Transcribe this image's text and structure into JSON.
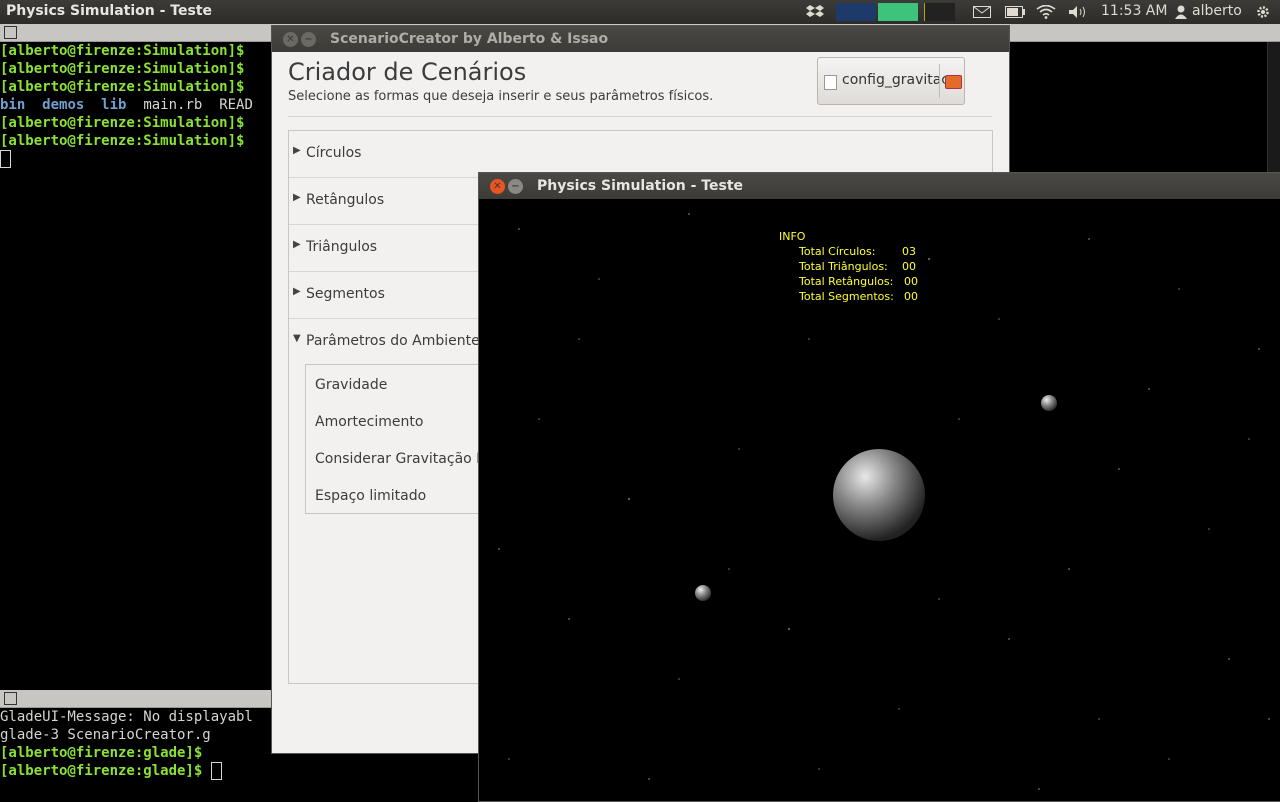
{
  "top_panel": {
    "app_title": "Physics Simulation - Teste",
    "time": "11:53 AM",
    "user": "alberto"
  },
  "terminal_top": {
    "lines": [
      "[alberto@firenze:Simulation]$",
      "[alberto@firenze:Simulation]$",
      "[alberto@firenze:Simulation]$",
      "[alberto@firenze:Simulation]$",
      "[alberto@firenze:Simulation]$"
    ],
    "ls": {
      "bin": "bin",
      "demos": "demos",
      "lib": "lib",
      "main": "main.rb",
      "readme": "READ"
    }
  },
  "terminal_bottom": {
    "lines": [
      "GladeUI-Message: No displayabl",
      "glade-3 ScenarioCreator.g",
      "[alberto@firenze:glade]$",
      "[alberto@firenze:glade]$"
    ]
  },
  "scenario_creator": {
    "window_title": "ScenarioCreator by Alberto & Issao",
    "heading": "Criador de Cenários",
    "subheading": "Selecione as formas que deseja inserir e seus parâmetros físicos.",
    "file_button": "config_gravitac...",
    "sections": [
      "Círculos",
      "Retângulos",
      "Triângulos",
      "Segmentos",
      "Parâmetros do Ambiente"
    ],
    "environment_params": [
      "Gravidade",
      "Amortecimento",
      "Considerar Gravitação Po",
      "Espaço limitado"
    ]
  },
  "physics_window": {
    "window_title": "Physics Simulation - Teste",
    "info": {
      "header": "INFO",
      "rows": [
        {
          "label": "Total Círculos:",
          "value": "03"
        },
        {
          "label": "Total Triângulos:",
          "value": "00"
        },
        {
          "label": "Total Retângulos:",
          "value": "00"
        },
        {
          "label": "Total Segmentos:",
          "value": "00"
        }
      ]
    }
  },
  "colors": {
    "panel_bg": "#3c3b37",
    "prompt_green": "#8ae234",
    "dir_blue": "#729fcf",
    "info_yellow": "#ffff33",
    "close_orange": "#e95420"
  }
}
